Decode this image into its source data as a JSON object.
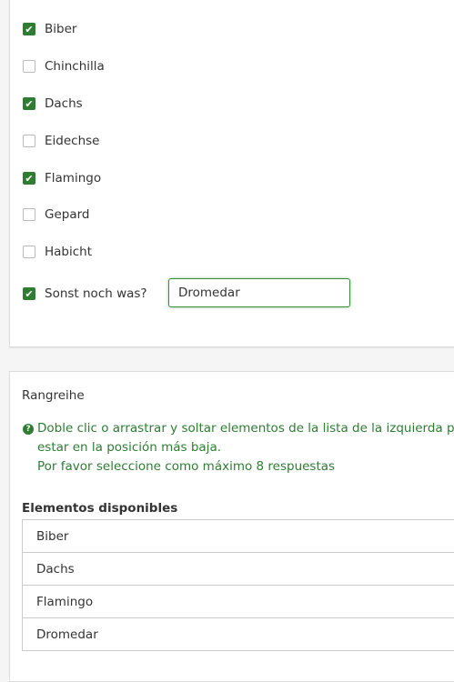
{
  "options": [
    {
      "label": "Biber",
      "checked": true
    },
    {
      "label": "Chinchilla",
      "checked": false
    },
    {
      "label": "Dachs",
      "checked": true
    },
    {
      "label": "Eidechse",
      "checked": false
    },
    {
      "label": "Flamingo",
      "checked": true
    },
    {
      "label": "Gepard",
      "checked": false
    },
    {
      "label": "Habicht",
      "checked": false
    }
  ],
  "other": {
    "label": "Sonst noch was?",
    "checked": true,
    "value": "Dromedar"
  },
  "ranking": {
    "title": "Rangreihe",
    "hint_line1": "Doble clic o arrastrar y soltar elementos de la lista de la izquierda para",
    "hint_line2": "estar en la posición más baja.",
    "hint_line3": "Por favor seleccione como máximo 8 respuestas",
    "available_heading": "Elementos disponibles",
    "available_items": [
      "Biber",
      "Dachs",
      "Flamingo",
      "Dromedar"
    ]
  },
  "colors": {
    "accent": "#2e7d32",
    "border": "#dddddd"
  }
}
